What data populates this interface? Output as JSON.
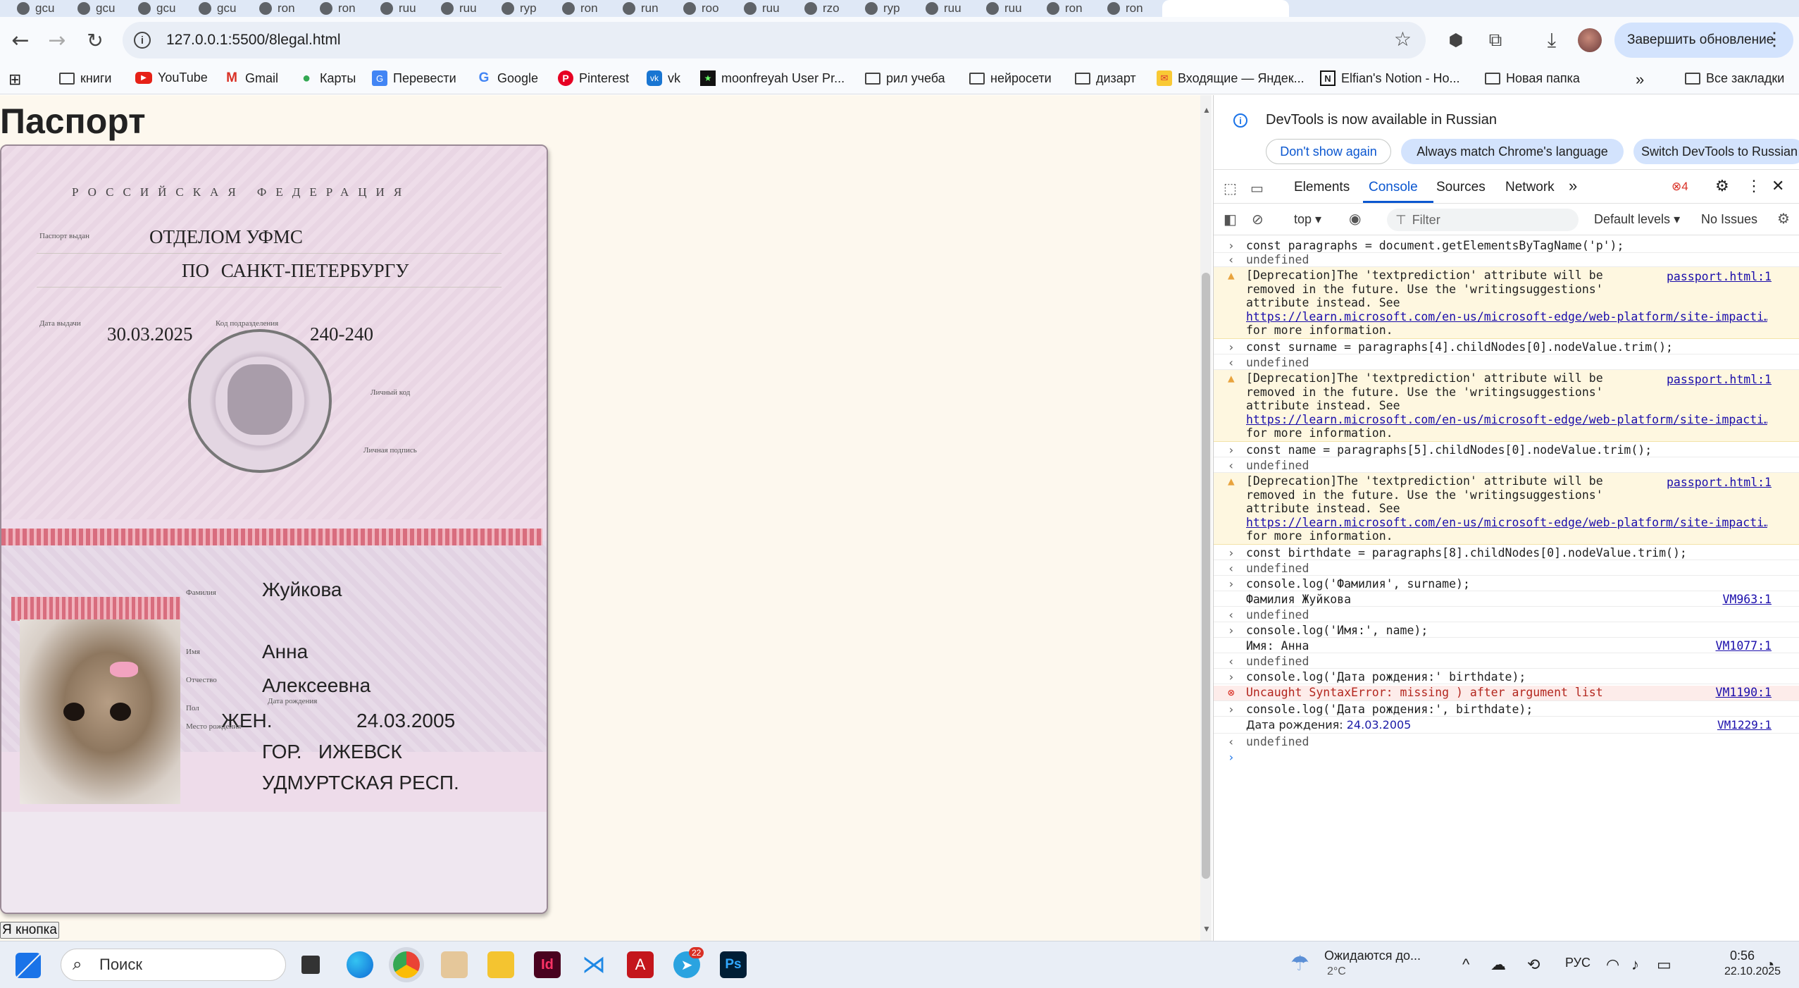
{
  "browser": {
    "tabs": [
      "gcu",
      "gcu",
      "gcu",
      "gcu",
      "ron",
      "ron",
      "ruu",
      "ruu",
      "ryp",
      "ron",
      "run",
      "roo",
      "ruu",
      "rzo",
      "ryp",
      "ruu",
      "ruu",
      "ron",
      "ron"
    ],
    "url": "127.0.0.1:5500/8legal.html",
    "update_button": "Завершить обновление",
    "icons": {
      "back": "back-arrow-icon",
      "forward": "forward-arrow-icon",
      "reload": "reload-icon",
      "star": "bookmark-star-icon"
    }
  },
  "bookmarks": {
    "items": [
      {
        "label": "книги",
        "icon": "folder-icon"
      },
      {
        "label": "YouTube",
        "icon": "youtube-icon"
      },
      {
        "label": "Gmail",
        "icon": "gmail-icon"
      },
      {
        "label": "Карты",
        "icon": "maps-icon"
      },
      {
        "label": "Перевести",
        "icon": "translate-icon"
      },
      {
        "label": "Google",
        "icon": "google-icon"
      },
      {
        "label": "Pinterest",
        "icon": "pinterest-icon"
      },
      {
        "label": "vk",
        "icon": "vk-icon"
      },
      {
        "label": "moonfreyah User Pr...",
        "icon": "site-icon"
      },
      {
        "label": "рил учеба",
        "icon": "folder-icon"
      },
      {
        "label": "нейросети",
        "icon": "folder-icon"
      },
      {
        "label": "дизарт",
        "icon": "folder-icon"
      },
      {
        "label": "Входящие — Яндек...",
        "icon": "yandex-mail-icon"
      },
      {
        "label": "Elfian's Notion - Ho...",
        "icon": "notion-icon"
      },
      {
        "label": "Новая папка",
        "icon": "folder-icon"
      }
    ],
    "all": "Все закладки"
  },
  "page": {
    "title": "Паспорт",
    "button": "Я кнопка",
    "passport": {
      "country": "РОССИЙСКАЯ ФЕДЕРАЦИЯ",
      "issued_by_label": "Паспорт выдан",
      "issued_by_1": "ОТДЕЛОМ УФМС",
      "issued_by_2": "ПО САНКТ-ПЕТЕРБУРГУ",
      "issue_date_label": "Дата выдачи",
      "issue_date": "30.03.2025",
      "code_label": "Код подразделения",
      "code": "240-240",
      "personal_code_label": "Личный код",
      "signature_label": "Личная подпись",
      "surname_label": "Фамилия",
      "surname": "Жуйкова",
      "name_label": "Имя",
      "name": "Анна",
      "patronymic_label": "Отчество",
      "patronymic": "Алексеевна",
      "sex_label": "Пол",
      "sex": "ЖЕН.",
      "birthdate_label": "Дата рождения",
      "birthdate": "24.03.2005",
      "birthplace_label": "Место рождения",
      "birthplace_1": "ГОР.   ИЖЕВСК",
      "birthplace_2": "УДМУРТСКАЯ РЕСП."
    }
  },
  "devtools": {
    "banner": "DevTools is now available in Russian",
    "banner_buttons": [
      "Don't show again",
      "Always match Chrome's language",
      "Switch DevTools to Russian"
    ],
    "tabs": [
      "Elements",
      "Console",
      "Sources",
      "Network"
    ],
    "error_count": "4",
    "context": "top",
    "filter_placeholder": "Filter",
    "levels": "Default levels",
    "issues": "No Issues",
    "console": {
      "l1": "const paragraphs = document.getElementsByTagName('p');",
      "undef": "undefined",
      "w1": "[Deprecation]The 'textprediction' attribute will be",
      "w2": "removed in the future. Use the 'writingsuggestions'",
      "w3": "attribute instead. See",
      "w4": "https://learn.microsoft.com/en-us/microsoft-edge/web-platform/site-impacti…",
      "w5": "for more information.",
      "wsrc": "passport.html:1",
      "l2": "const surname = paragraphs[4].childNodes[0].nodeValue.trim();",
      "l3": "const name = paragraphs[5].childNodes[0].nodeValue.trim();",
      "l4": "const birthdate = paragraphs[8].childNodes[0].nodeValue.trim();",
      "l5": "console.log('Фамилия', surname);",
      "o5": "Фамилия Жуйкова",
      "s5": "VM963:1",
      "l6": "console.log('Имя:', name);",
      "o6": "Имя: Анна",
      "s6": "VM1077:1",
      "l7": "console.log('Дата рождения:' birthdate);",
      "e7": "Uncaught SyntaxError: missing ) after argument list",
      "s7": "VM1190:1",
      "l8": "console.log('Дата рождения:', birthdate);",
      "o8a": "Дата рождения: ",
      "o8b": "24.03.2005",
      "s8": "VM1229:1"
    }
  },
  "taskbar": {
    "search": "Поиск",
    "telegram_badge": "22",
    "weather": "Ожидаются до...",
    "temp": "2°C",
    "lang": "РУС",
    "time": "0:56",
    "date": "22.10.2025"
  }
}
